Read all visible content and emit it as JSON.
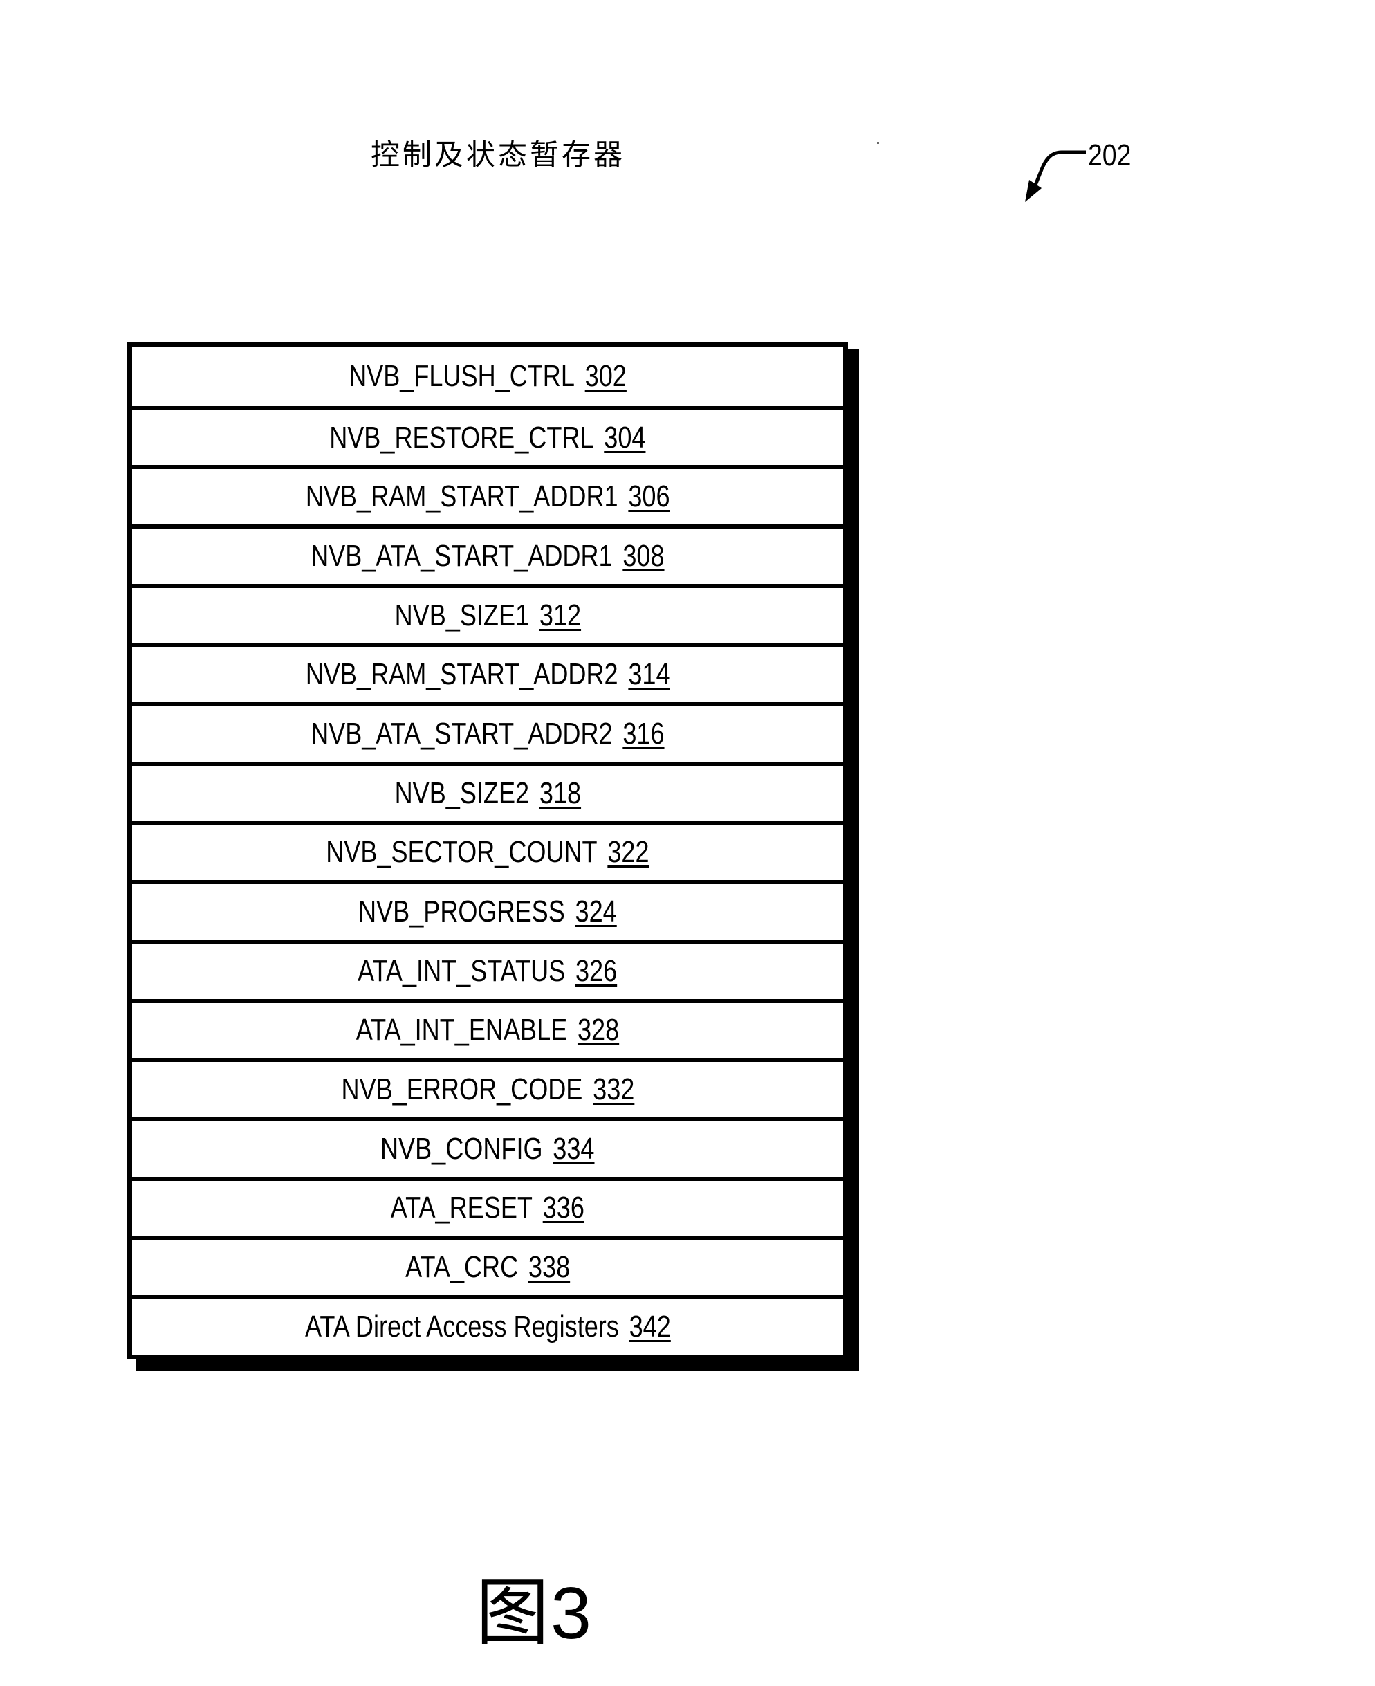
{
  "diagram": {
    "title": "控制及状态暂存器",
    "reference_label": "202",
    "registers": [
      {
        "name": "NVB_FLUSH_CTRL",
        "ref": "302"
      },
      {
        "name": "NVB_RESTORE_CTRL",
        "ref": "304"
      },
      {
        "name": "NVB_RAM_START_ADDR1",
        "ref": "306"
      },
      {
        "name": "NVB_ATA_START_ADDR1",
        "ref": "308"
      },
      {
        "name": "NVB_SIZE1",
        "ref": "312"
      },
      {
        "name": "NVB_RAM_START_ADDR2",
        "ref": "314"
      },
      {
        "name": "NVB_ATA_START_ADDR2",
        "ref": "316"
      },
      {
        "name": "NVB_SIZE2",
        "ref": "318"
      },
      {
        "name": "NVB_SECTOR_COUNT",
        "ref": "322"
      },
      {
        "name": "NVB_PROGRESS",
        "ref": "324"
      },
      {
        "name": "ATA_INT_STATUS",
        "ref": "326"
      },
      {
        "name": "ATA_INT_ENABLE",
        "ref": "328"
      },
      {
        "name": "NVB_ERROR_CODE",
        "ref": "332"
      },
      {
        "name": "NVB_CONFIG",
        "ref": "334"
      },
      {
        "name": "ATA_RESET",
        "ref": "336"
      },
      {
        "name": "ATA_CRC",
        "ref": "338"
      },
      {
        "name": "ATA Direct Access Registers",
        "ref": "342"
      }
    ],
    "figure_label": {
      "prefix": "图",
      "number": "3"
    }
  }
}
